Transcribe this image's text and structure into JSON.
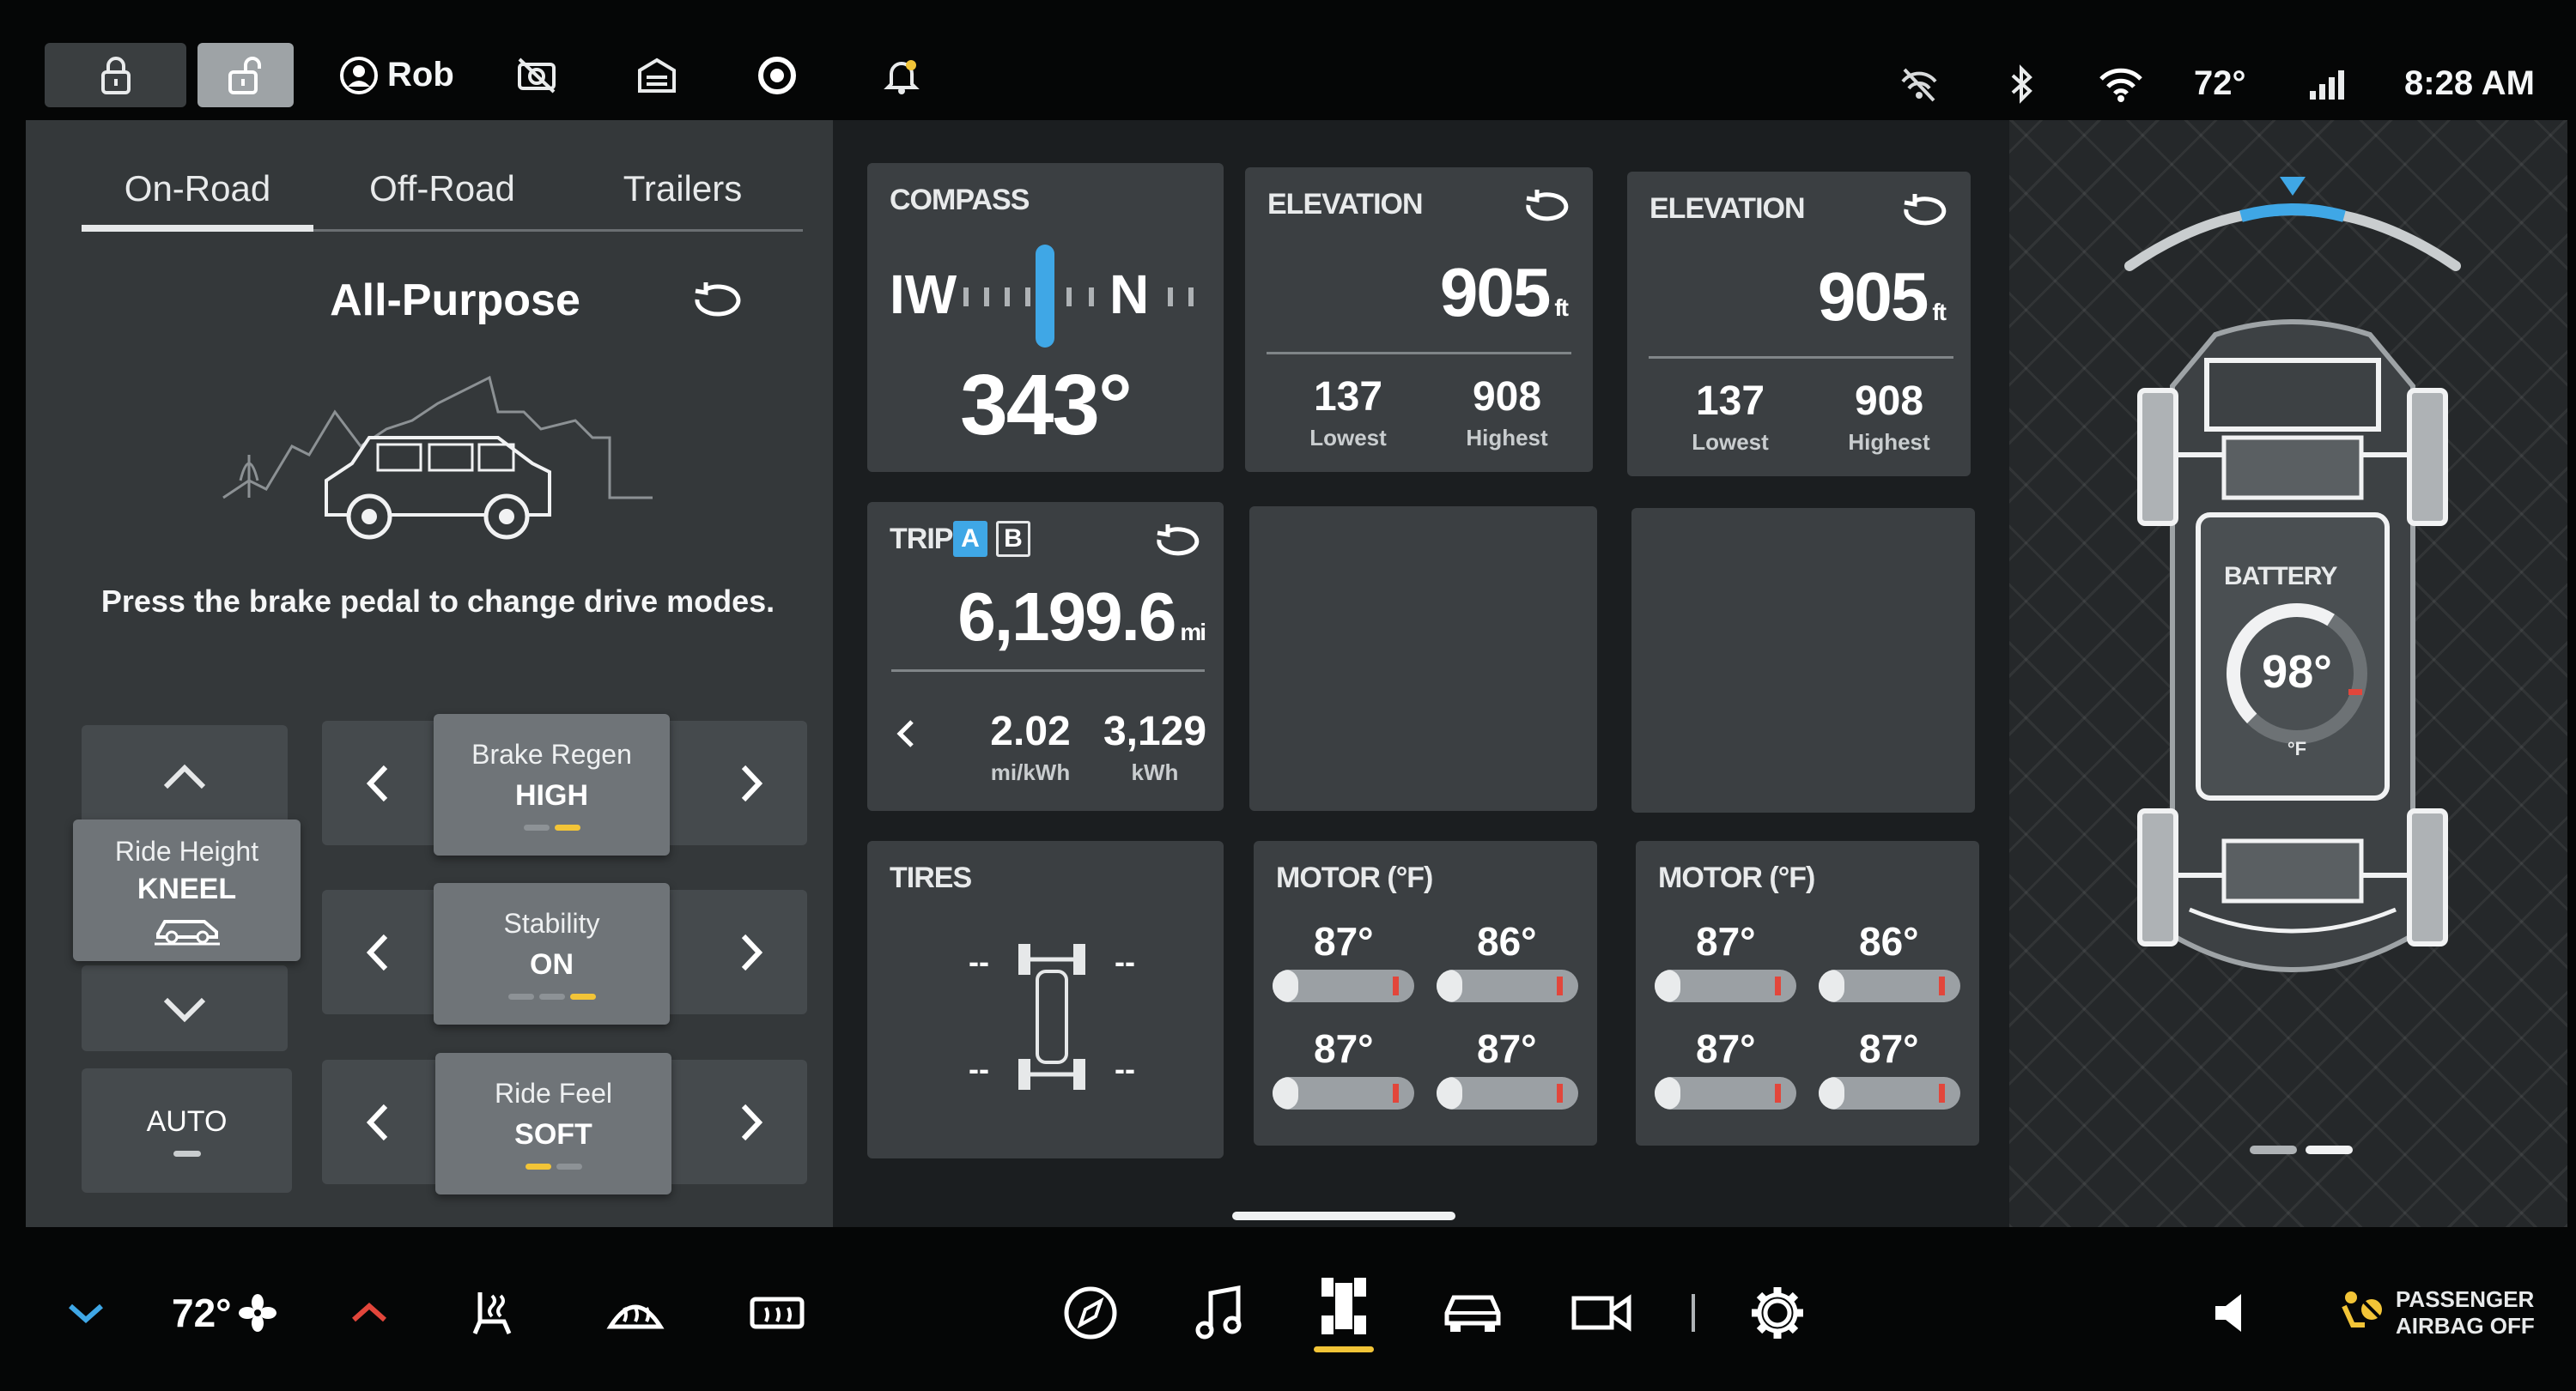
{
  "topbar": {
    "user_name": "Rob",
    "temperature": "72°",
    "time": "8:28 AM"
  },
  "drive": {
    "tabs": [
      {
        "label": "On-Road",
        "active": true
      },
      {
        "label": "Off-Road",
        "active": false
      },
      {
        "label": "Trailers",
        "active": false
      }
    ],
    "mode_name": "All-Purpose",
    "hint": "Press the brake pedal to change drive modes.",
    "ride_height": {
      "label": "Ride Height",
      "value": "KNEEL"
    },
    "auto_label": "AUTO",
    "brake_regen": {
      "label": "Brake Regen",
      "value": "HIGH",
      "level": 2,
      "levels": 2
    },
    "stability": {
      "label": "Stability",
      "value": "ON",
      "level": 3,
      "levels": 3
    },
    "ride_feel": {
      "label": "Ride Feel",
      "value": "SOFT",
      "level": 1,
      "levels": 2
    }
  },
  "widgets": {
    "compass": {
      "title": "COMPASS",
      "heading": "343°",
      "scale_left": "IW",
      "scale_right": "N"
    },
    "elevation1": {
      "title": "ELEVATION",
      "value": "905",
      "unit": "ft",
      "lowest": "137",
      "lowest_label": "Lowest",
      "highest": "908",
      "highest_label": "Highest"
    },
    "elevation2": {
      "title": "ELEVATION",
      "value": "905",
      "unit": "ft",
      "lowest": "137",
      "lowest_label": "Lowest",
      "highest": "908",
      "highest_label": "Highest"
    },
    "trip": {
      "title": "TRIP",
      "tab_a": "A",
      "tab_b": "B",
      "distance": "6,199.6",
      "unit": "mi",
      "efficiency": "2.02",
      "efficiency_unit": "mi/kWh",
      "energy": "3,129",
      "energy_unit": "kWh"
    },
    "tires": {
      "title": "TIRES",
      "fl": "--",
      "fr": "--",
      "rl": "--",
      "rr": "--"
    },
    "motor1": {
      "title": "MOTOR (°F)",
      "temps": [
        "87°",
        "86°",
        "87°",
        "87°"
      ],
      "fills": [
        0.18,
        0.18,
        0.18,
        0.18
      ]
    },
    "motor2": {
      "title": "MOTOR (°F)",
      "temps": [
        "87°",
        "86°",
        "87°",
        "87°"
      ],
      "fills": [
        0.18,
        0.18,
        0.18,
        0.18
      ]
    }
  },
  "vehicle": {
    "battery_label": "BATTERY",
    "battery_temp": "98°",
    "battery_unit": "°F",
    "battery_fraction": 0.62
  },
  "bottombar": {
    "cabin_temp": "72°",
    "airbag_line1": "PASSENGER",
    "airbag_line2": "AIRBAG OFF"
  },
  "colors": {
    "accent_blue": "#3fa7e6",
    "accent_yellow": "#f2c437",
    "warn_red": "#e2463b"
  }
}
